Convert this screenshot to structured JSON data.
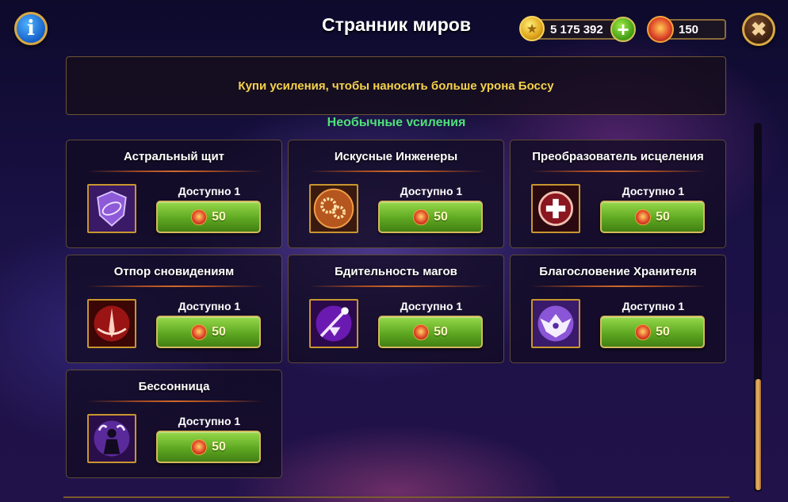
{
  "header": {
    "title": "Странник миров",
    "gold_amount": "5 175 392",
    "ember_amount": "150",
    "info_icon": "info-icon",
    "close_icon": "close-icon"
  },
  "banner": {
    "text": "Купи усиления, чтобы наносить больше урона Боссу"
  },
  "section": {
    "title": "Необычные усиления"
  },
  "cards": [
    {
      "title": "Астральный щит",
      "available": "Доступно 1",
      "price": "50",
      "icon": "astral-shield-icon"
    },
    {
      "title": "Искусные Инженеры",
      "available": "Доступно 1",
      "price": "50",
      "icon": "gears-icon"
    },
    {
      "title": "Преобразователь исцеления",
      "available": "Доступно 1",
      "price": "50",
      "icon": "heal-converter-icon"
    },
    {
      "title": "Отпор сновидениям",
      "available": "Доступно 1",
      "price": "50",
      "icon": "dream-repel-icon"
    },
    {
      "title": "Бдительность магов",
      "available": "Доступно 1",
      "price": "50",
      "icon": "mage-vigilance-icon"
    },
    {
      "title": "Благословение Хранителя",
      "available": "Доступно 1",
      "price": "50",
      "icon": "guardian-blessing-icon"
    },
    {
      "title": "Бессонница",
      "available": "Доступно 1",
      "price": "50",
      "icon": "insomnia-icon"
    }
  ],
  "colors": {
    "accent_gold": "#f5d24a",
    "section_green": "#4fe07a",
    "buy_button_green": "#5ea821",
    "frame_gold": "#c9962e"
  }
}
